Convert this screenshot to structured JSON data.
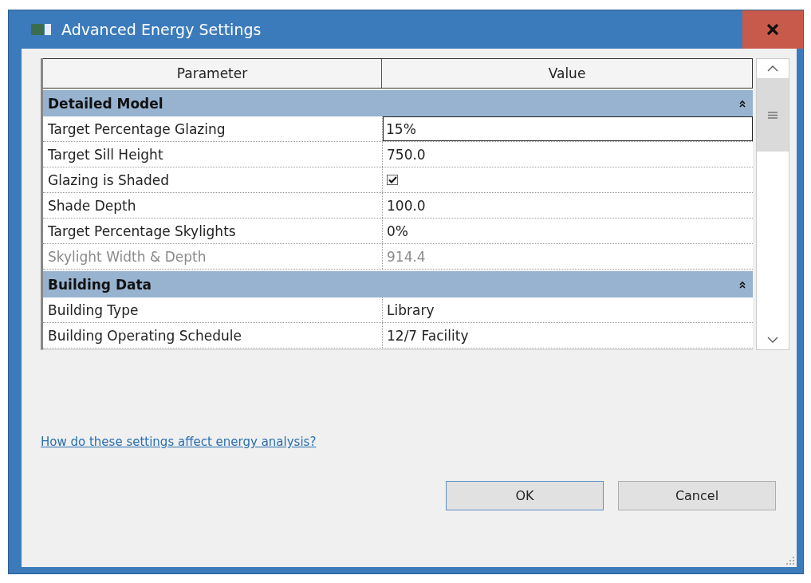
{
  "window": {
    "title": "Advanced Energy Settings"
  },
  "grid": {
    "columns": [
      "Parameter",
      "Value"
    ],
    "groups": [
      {
        "title": "Detailed Model",
        "expanded": true,
        "rows": [
          {
            "kind": "text",
            "name": "Target Percentage Glazing",
            "value": "15%",
            "selected": true,
            "disabled": false
          },
          {
            "kind": "text",
            "name": "Target Sill Height",
            "value": "750.0",
            "selected": false,
            "disabled": false
          },
          {
            "kind": "checkbox",
            "name": "Glazing is Shaded",
            "checked": true,
            "selected": false,
            "disabled": false
          },
          {
            "kind": "text",
            "name": "Shade Depth",
            "value": "100.0",
            "selected": false,
            "disabled": false
          },
          {
            "kind": "text",
            "name": "Target Percentage Skylights",
            "value": "0%",
            "selected": false,
            "disabled": false
          },
          {
            "kind": "text",
            "name": "Skylight Width & Depth",
            "value": "914.4",
            "selected": false,
            "disabled": true
          }
        ]
      },
      {
        "title": "Building Data",
        "expanded": true,
        "rows": [
          {
            "kind": "text",
            "name": "Building Type",
            "value": "Library",
            "selected": false,
            "disabled": false
          },
          {
            "kind": "text",
            "name": "Building Operating Schedule",
            "value": "12/7 Facility",
            "selected": false,
            "disabled": false
          }
        ]
      }
    ]
  },
  "help_link": "How do these settings affect energy analysis?",
  "buttons": [
    "OK",
    "Cancel"
  ]
}
